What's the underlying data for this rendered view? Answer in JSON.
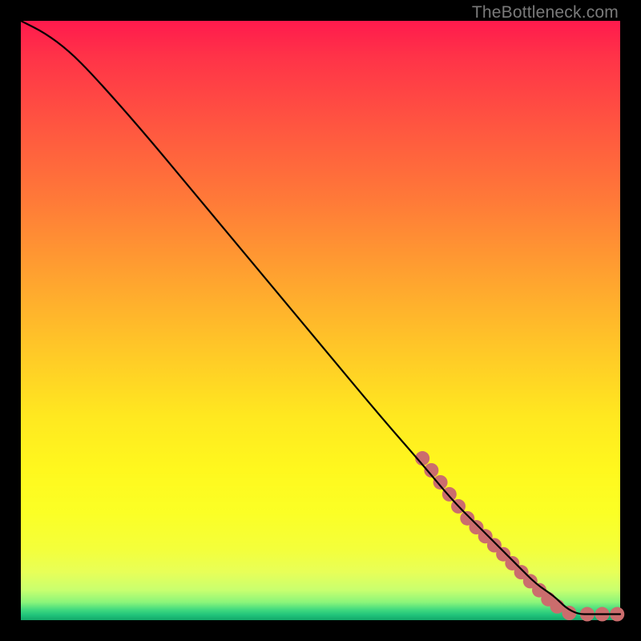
{
  "watermark": "TheBottleneck.com",
  "chart_data": {
    "type": "line",
    "title": "",
    "xlabel": "",
    "ylabel": "",
    "xlim": [
      0,
      100
    ],
    "ylim": [
      0,
      100
    ],
    "grid": false,
    "legend": false,
    "series": [
      {
        "name": "bottleneck-curve",
        "color": "#000000",
        "x": [
          0,
          4,
          8,
          12,
          20,
          30,
          40,
          50,
          60,
          67,
          72,
          76,
          80,
          83,
          86,
          89,
          91,
          93,
          95,
          97,
          100
        ],
        "y": [
          100,
          98,
          95,
          91,
          82,
          70,
          58,
          46,
          34,
          26,
          20,
          16,
          12,
          9,
          6,
          4,
          2,
          1,
          1,
          1,
          1
        ]
      }
    ],
    "markers": {
      "name": "highlight-dots",
      "color": "#cb6d6d",
      "radius_px": 9,
      "points": [
        {
          "x": 67.0,
          "y": 27.0
        },
        {
          "x": 68.5,
          "y": 25.0
        },
        {
          "x": 70.0,
          "y": 23.0
        },
        {
          "x": 71.5,
          "y": 21.0
        },
        {
          "x": 73.0,
          "y": 19.0
        },
        {
          "x": 74.5,
          "y": 17.0
        },
        {
          "x": 76.0,
          "y": 15.5
        },
        {
          "x": 77.5,
          "y": 14.0
        },
        {
          "x": 79.0,
          "y": 12.5
        },
        {
          "x": 80.5,
          "y": 11.0
        },
        {
          "x": 82.0,
          "y": 9.5
        },
        {
          "x": 83.5,
          "y": 8.0
        },
        {
          "x": 85.0,
          "y": 6.5
        },
        {
          "x": 86.5,
          "y": 5.0
        },
        {
          "x": 88.0,
          "y": 3.5
        },
        {
          "x": 89.5,
          "y": 2.3
        },
        {
          "x": 91.5,
          "y": 1.2
        },
        {
          "x": 94.5,
          "y": 1.0
        },
        {
          "x": 97.0,
          "y": 1.0
        },
        {
          "x": 99.5,
          "y": 1.0
        }
      ]
    }
  }
}
